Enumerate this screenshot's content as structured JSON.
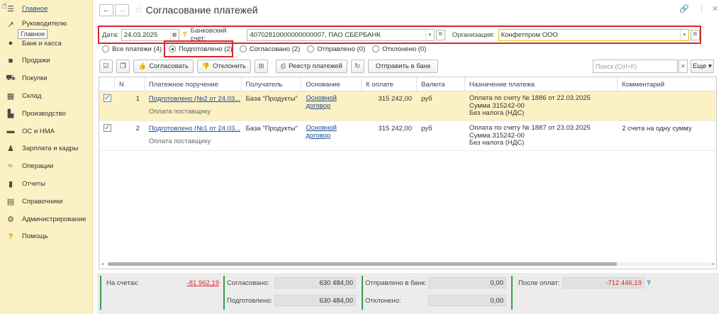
{
  "sidebar": {
    "items": [
      {
        "label": "Главное",
        "icon": "menu-icon"
      },
      {
        "label": "Руководителю",
        "icon": "chart-trend-icon"
      },
      {
        "label": "Банк и касса",
        "icon": "coin-icon"
      },
      {
        "label": "Продажи",
        "icon": "bag-icon"
      },
      {
        "label": "Покупки",
        "icon": "cart-icon"
      },
      {
        "label": "Склад",
        "icon": "grid-icon"
      },
      {
        "label": "Производство",
        "icon": "factory-icon"
      },
      {
        "label": "ОС и НМА",
        "icon": "truck-icon"
      },
      {
        "label": "Зарплата и кадры",
        "icon": "person-icon"
      },
      {
        "label": "Операции",
        "icon": "operations-icon"
      },
      {
        "label": "Отчеты",
        "icon": "bar-chart-icon"
      },
      {
        "label": "Справочники",
        "icon": "book-icon"
      },
      {
        "label": "Администрирование",
        "icon": "gear-icon"
      },
      {
        "label": "Помощь",
        "icon": "help-icon"
      }
    ],
    "tooltip": "Главное"
  },
  "header": {
    "title": "Согласование платежей"
  },
  "filters": {
    "date_label": "Дата:",
    "date_value": "24.03.2025",
    "account_label": "Банковский счет:",
    "account_value": "40702810000000000007, ПАО СБЕРБАНК",
    "org_label": "Организация:",
    "org_value": "Конфетпром ООО"
  },
  "radios": [
    {
      "label": "Все платежи (4)",
      "selected": false
    },
    {
      "label": "Подготовлено (2)",
      "selected": true
    },
    {
      "label": "Согласовано (2)",
      "selected": false
    },
    {
      "label": "Отправлено (0)",
      "selected": false
    },
    {
      "label": "Отклонено (0)",
      "selected": false
    }
  ],
  "toolbar": {
    "approve_label": "Согласовать",
    "reject_label": "Отклонить",
    "registry_label": "Реестр платежей",
    "send_label": "Отправить в банк",
    "search_placeholder": "Поиск (Ctrl+F)",
    "more_label": "Еще"
  },
  "table": {
    "columns": [
      "N",
      "Платежное поручение",
      "Получатель",
      "Основание",
      "К оплате",
      "Валюта",
      "Назначение платежа",
      "Комментарий"
    ],
    "rows": [
      {
        "n": "1",
        "order": "Подготовлено (№2 от 24.03...",
        "order_sub": "Оплата поставщику",
        "recipient": "База \"Продукты\"",
        "basis_line1": "Основной",
        "basis_line2": "договор",
        "amount": "315 242,00",
        "currency": "руб",
        "purpose_line1": "Оплата по счету № 1886 от 22.03.2025",
        "purpose_line2": "Сумма 315242-00",
        "purpose_line3": "Без налога (НДС)",
        "comment": ""
      },
      {
        "n": "2",
        "order": "Подготовлено (№1 от 24.03...",
        "order_sub": "Оплата поставщику",
        "recipient": "База \"Продукты\"",
        "basis_line1": "Основной",
        "basis_line2": "договор",
        "amount": "315 242,00",
        "currency": "руб",
        "purpose_line1": "Оплата по счету № 1887 от 23.03.2025",
        "purpose_line2": "Сумма 315242-00",
        "purpose_line3": "Без налога (НДС)",
        "comment": "2 счета на одну сумму"
      }
    ]
  },
  "footer": {
    "accounts_label": "На счетах:",
    "accounts_value": "-81 962,19",
    "approved_label": "Согласовано:",
    "approved_value": "630 484,00",
    "prepared_label": "Подготовлено:",
    "prepared_value": "630 484,00",
    "sent_label": "Отправлено в банк:",
    "sent_value": "0,00",
    "rejected_label": "Отклонено:",
    "rejected_value": "0,00",
    "after_label": "После оплат:",
    "after_value": "-712 446,19",
    "help_mark": "?"
  },
  "colors": {
    "accent_red": "#d9262c",
    "sidebar_bg": "#fbf1c4",
    "link_blue": "#1f4b8f",
    "footer_green": "#3a9a4a"
  }
}
